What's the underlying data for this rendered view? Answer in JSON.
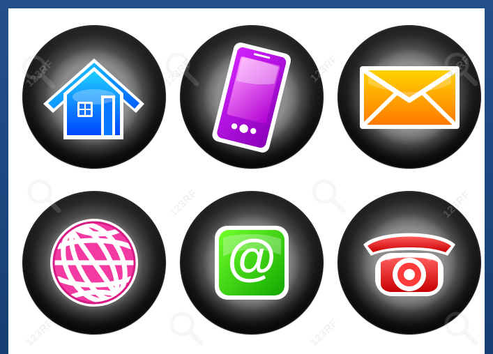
{
  "watermark": {
    "text": "123RF",
    "color": "#d0d0d0"
  },
  "icons": [
    {
      "name": "home-icon",
      "colors": {
        "primary": "#1686ff",
        "secondary": "#00c8ff",
        "outline": "#ffffff"
      }
    },
    {
      "name": "phone-icon",
      "colors": {
        "primary": "#c20ddd",
        "secondary": "#ff7dff",
        "outline": "#ffffff"
      }
    },
    {
      "name": "envelope-icon",
      "colors": {
        "primary": "#ffb000",
        "secondary": "#ff7a00",
        "outline": "#ffffff"
      }
    },
    {
      "name": "globe-icon",
      "colors": {
        "primary": "#ff4fb6",
        "secondary": "#d9138d",
        "outline": "#ffffff"
      }
    },
    {
      "name": "at-sign-icon",
      "colors": {
        "primary": "#39d100",
        "secondary": "#11a800",
        "outline": "#ffffff"
      }
    },
    {
      "name": "telephone-icon",
      "colors": {
        "primary": "#ff2323",
        "secondary": "#bf0000",
        "outline": "#ffffff"
      }
    }
  ]
}
